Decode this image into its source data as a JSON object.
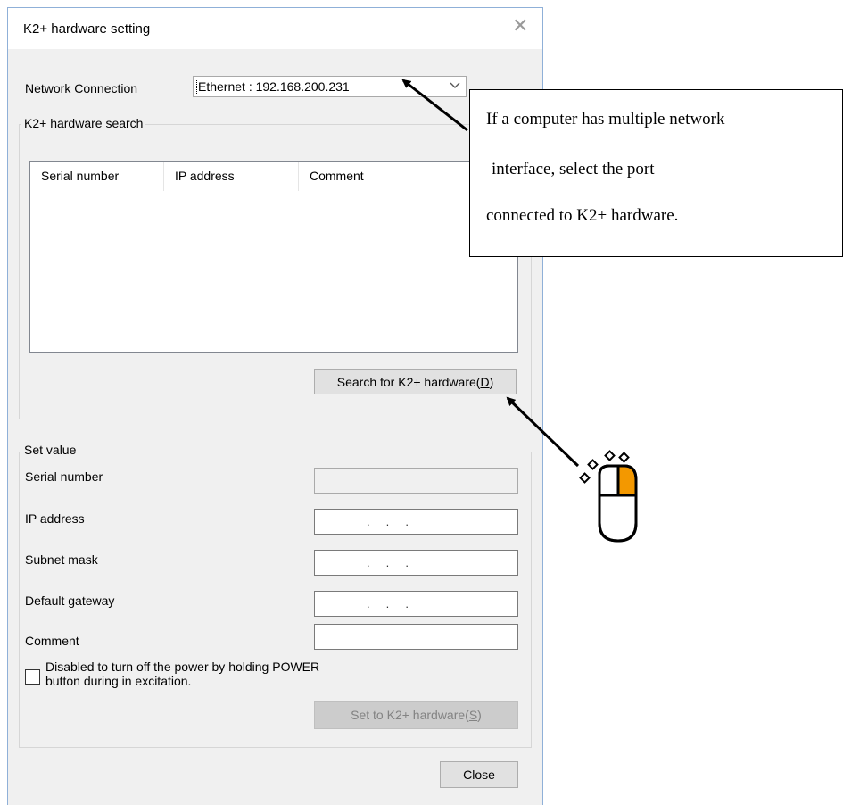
{
  "window": {
    "title": "K2+ hardware setting"
  },
  "network": {
    "label": "Network Connection",
    "selected": "Ethernet : 192.168.200.231"
  },
  "search_group": {
    "legend": "K2+ hardware search",
    "columns": [
      "Serial number",
      "IP address",
      "Comment"
    ],
    "button_label": "Search for K2+ hardware(D)",
    "button_prefix": "Search for K2+ hardware(",
    "button_mnemonic": "D",
    "button_suffix": ")"
  },
  "set_value": {
    "legend": "Set value",
    "serial_label": "Serial number",
    "ip_label": "IP address",
    "subnet_label": "Subnet mask",
    "gateway_label": "Default gateway",
    "comment_label": "Comment",
    "ip_dots": ".     .     .",
    "checkbox_line1": "Disabled to turn off the power by holding POWER",
    "checkbox_line2": "button during in excitation.",
    "set_button_prefix": "Set to K2+ hardware(",
    "set_button_mnemonic": "S",
    "set_button_suffix": ")"
  },
  "close_button": "Close",
  "callout": {
    "line1": "If a computer has multiple network",
    "line2": "interface, select the port",
    "line3": "connected to K2+ hardware."
  },
  "colors": {
    "mouse_button": "#f39800",
    "dialog_bg": "#f0f0f0"
  },
  "icons": [
    "close-icon",
    "dropdown-arrow-icon",
    "mouse-icon"
  ]
}
